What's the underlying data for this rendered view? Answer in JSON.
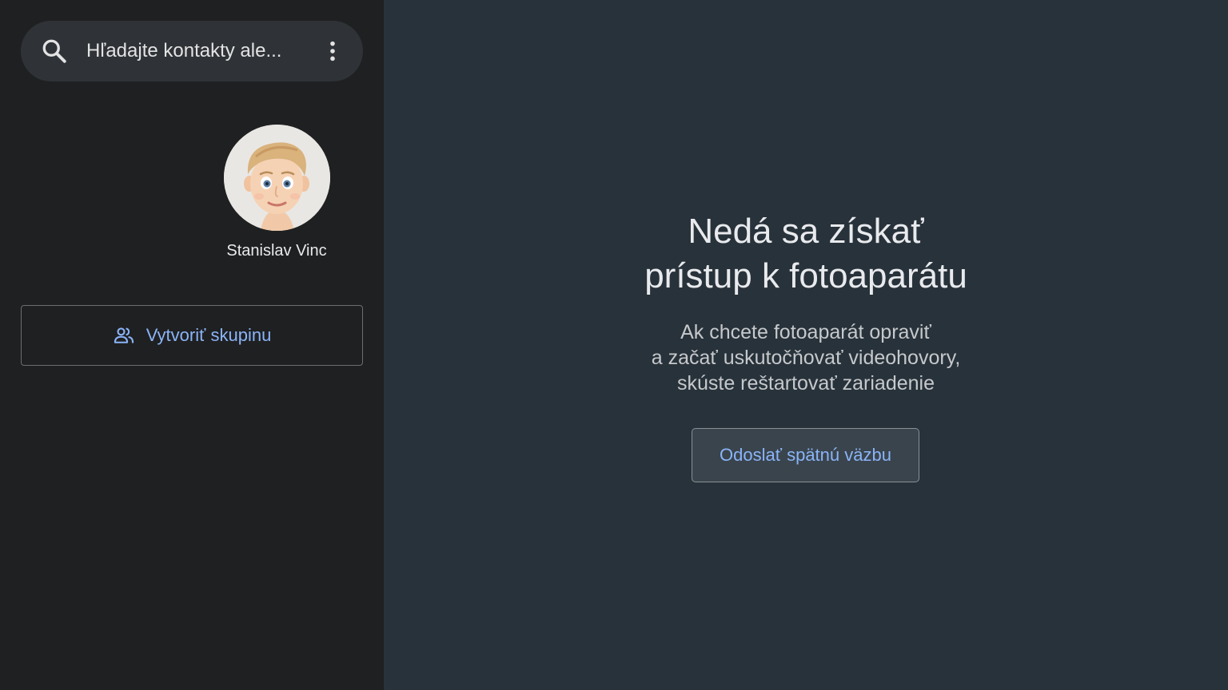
{
  "sidebar": {
    "search": {
      "placeholder": "Hľadajte kontakty ale...",
      "search_icon": "search-icon",
      "menu_icon": "more-vert-icon"
    },
    "contact": {
      "name": "Stanislav Vinc",
      "avatar_icon": "memoji-avatar"
    },
    "create_group": {
      "label": "Vytvoriť skupinu",
      "icon": "group-icon"
    }
  },
  "main": {
    "title_lines": [
      "Nedá sa získať",
      "prístup k fotoaparátu"
    ],
    "body_lines": [
      "Ak chcete fotoaparát opraviť",
      "a začať uskutočňovať videohovory,",
      "skúste reštartovať zariadenie"
    ],
    "feedback_button": "Odoslať spätnú väzbu"
  },
  "colors": {
    "sidebar_bg": "#1f2021",
    "main_bg": "#28323a",
    "accent": "#8ab4f8",
    "text": "#e8eaed"
  }
}
